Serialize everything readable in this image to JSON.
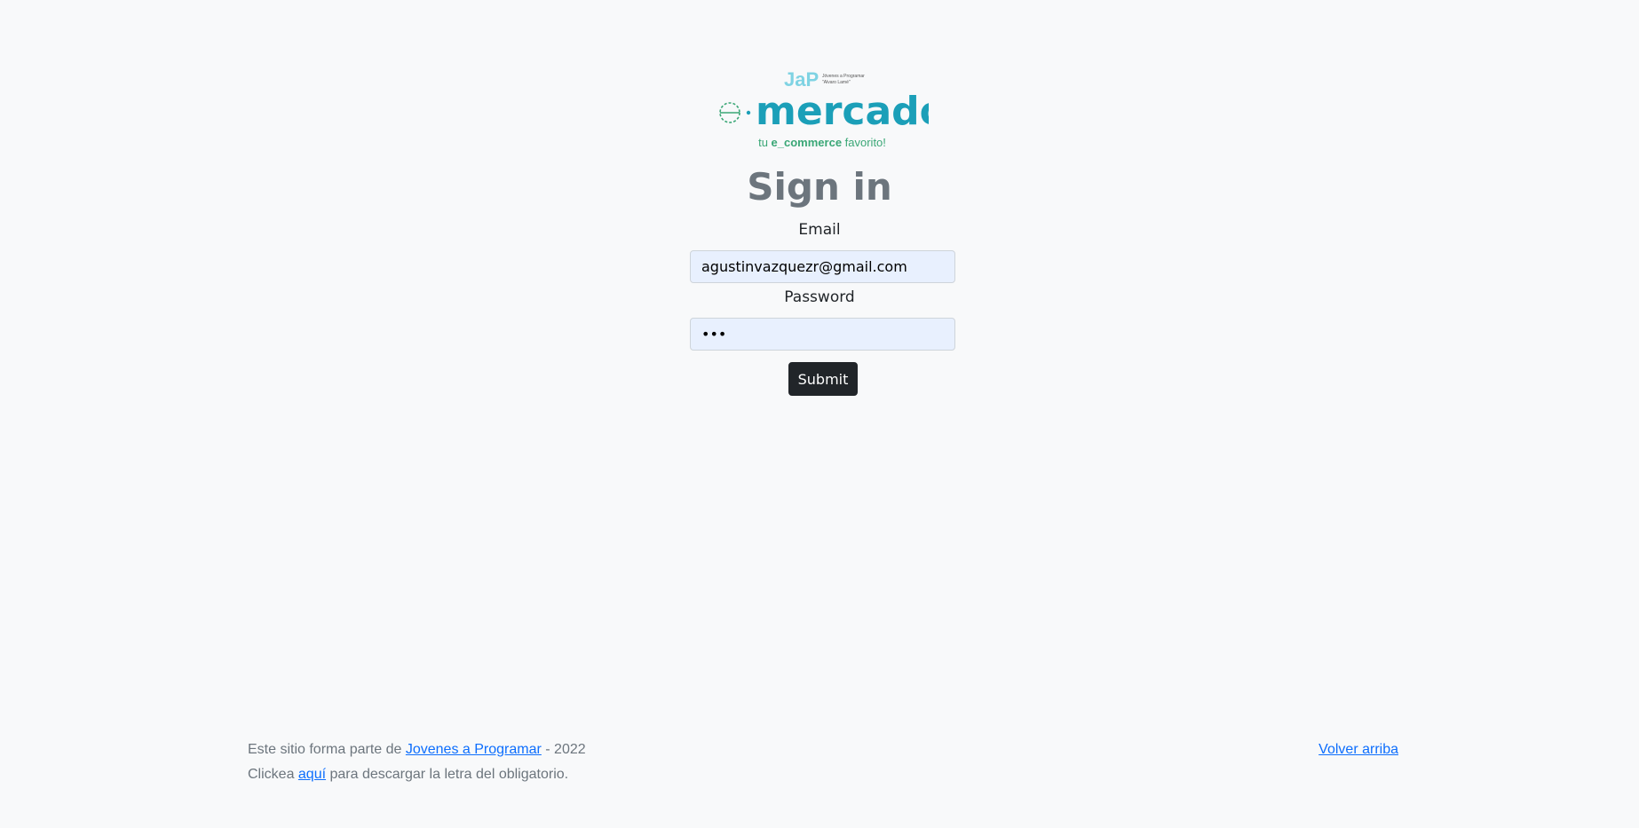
{
  "logo": {
    "badge_text": "JaP",
    "badge_caption_1": "Jóvenes a Programar",
    "badge_caption_2": "\"Alvaro Lamé\"",
    "brand_prefix": "e",
    "brand_name": "mercado",
    "tagline_part1": "tu ",
    "tagline_bold": "e_commerce",
    "tagline_part2": " favorito!"
  },
  "form": {
    "title": "Sign in",
    "email_label": "Email",
    "email_value": "agustinvazquezr@gmail.com",
    "password_label": "Password",
    "password_value": "•••",
    "submit_label": "Submit"
  },
  "footer": {
    "line1_prefix": "Este sitio forma parte de ",
    "line1_link": "Jovenes a Programar",
    "line1_suffix": " - 2022",
    "line2_prefix": "Clickea ",
    "line2_link": "aquí",
    "line2_suffix": " para descargar la letra del obligatorio.",
    "back_to_top": "Volver arriba"
  },
  "colors": {
    "background": "#f8f9fa",
    "brand": "#1b9fb8",
    "brand_green": "#3aa776",
    "title": "#6c757d",
    "button": "#212529",
    "link": "#0d6efd",
    "input_fill": "#e8f0fe"
  }
}
